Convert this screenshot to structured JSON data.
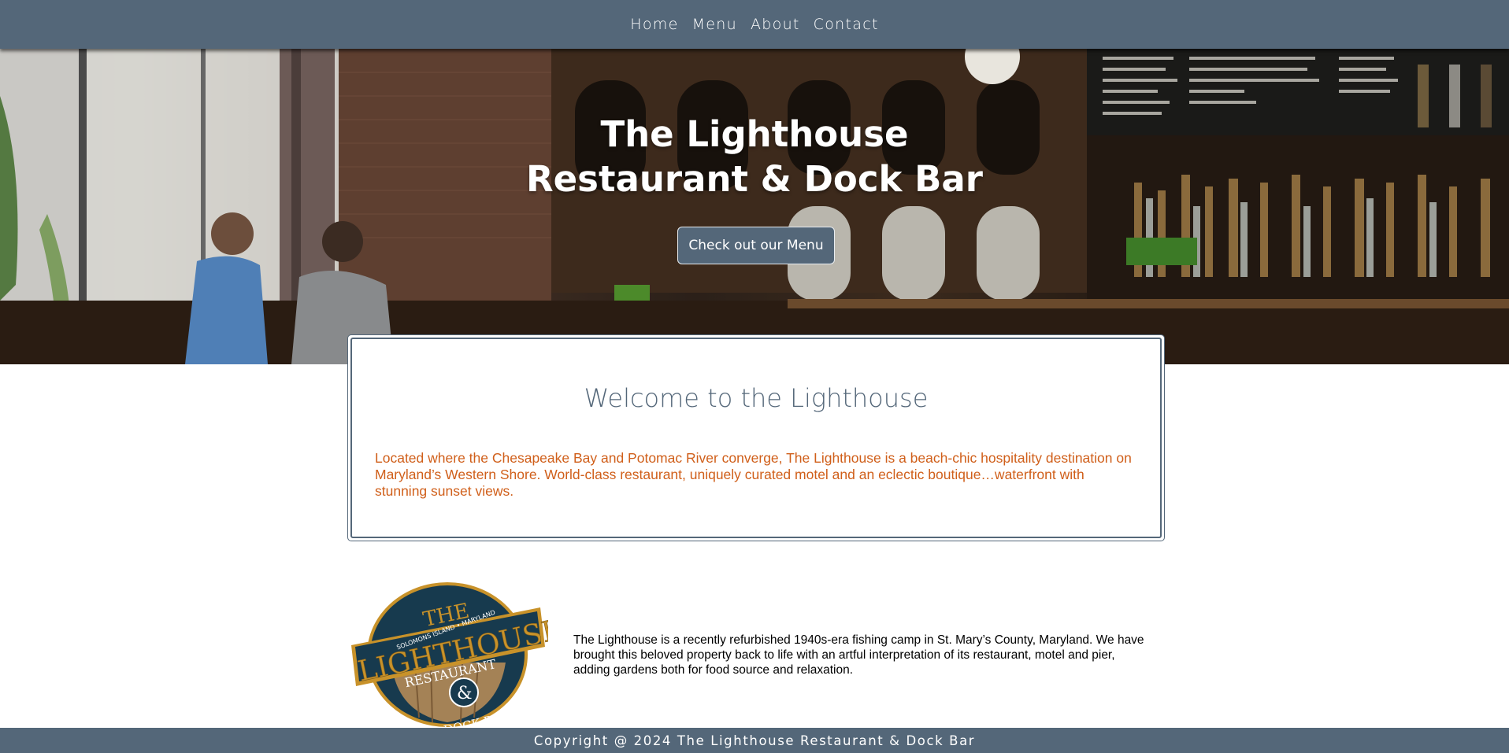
{
  "nav": {
    "items": [
      {
        "label": "Home"
      },
      {
        "label": "Menu"
      },
      {
        "label": "About"
      },
      {
        "label": "Contact"
      }
    ]
  },
  "hero": {
    "title_line1": "The Lighthouse",
    "title_line2": "Restaurant & Dock Bar",
    "cta_label": "Check out our Menu",
    "background_image": "bar-interior-photo"
  },
  "welcome": {
    "heading": "Welcome to the Lighthouse",
    "body": "Located where the Chesapeake Bay and Potomac River converge, The Lighthouse is a beach-chic hospitality destination on Maryland’s Western Shore. World-class restaurant, uniquely curated motel and an eclectic boutique…waterfront with stunning sunset views."
  },
  "about": {
    "logo": {
      "top_arc": "SOLOMONS ISLAND • MARYLAND",
      "word_the": "THE",
      "word_lighthouse": "LIGHTHOUSE",
      "word_restaurant": "RESTAURANT",
      "ampersand": "&",
      "word_dockbar": "DOCK BAR"
    },
    "text": "The Lighthouse is a recently refurbished 1940s-era fishing camp in St. Mary’s County, Maryland. We have brought this beloved property back to life with an artful interpretation of its restaurant, motel and pier, adding gardens both for food source and relaxation."
  },
  "footer": {
    "copyright": "Copyright @ 2024 The Lighthouse Restaurant & Dock Bar"
  },
  "colors": {
    "slate": "#546779",
    "accent_orange": "#d05f1a",
    "logo_navy": "#173a4e",
    "logo_gold": "#c8922a"
  }
}
